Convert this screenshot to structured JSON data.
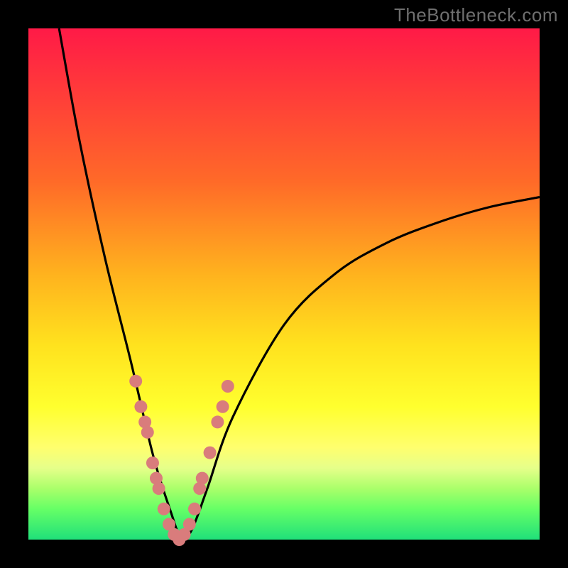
{
  "watermark": "TheBottleneck.com",
  "colors": {
    "frame": "#000000",
    "curve": "#000000",
    "marker": "#d97c7c",
    "gradient_top": "#ff1a47",
    "gradient_bottom": "#20e07a"
  },
  "chart_data": {
    "type": "line",
    "title": "",
    "xlabel": "",
    "ylabel": "",
    "xlim": [
      0,
      100
    ],
    "ylim": [
      0,
      100
    ],
    "grid": false,
    "legend": false,
    "series": [
      {
        "name": "bottleneck-curve",
        "x": [
          6,
          10,
          15,
          20,
          24,
          26,
          28,
          29,
          30,
          32,
          35,
          40,
          50,
          60,
          70,
          80,
          90,
          100
        ],
        "y": [
          100,
          78,
          55,
          35,
          18,
          11,
          5,
          2,
          0,
          2,
          10,
          24,
          42,
          52,
          58,
          62,
          65,
          67
        ]
      }
    ],
    "markers": {
      "name": "highlighted-points",
      "x": [
        21.0,
        22.0,
        22.8,
        23.3,
        24.3,
        25.0,
        25.5,
        26.5,
        27.5,
        28.5,
        29.5,
        30.5,
        31.5,
        32.5,
        33.5,
        34.0,
        35.5,
        37.0,
        38.0,
        39.0
      ],
      "y": [
        31,
        26,
        23,
        21,
        15,
        12,
        10,
        6,
        3,
        1,
        0,
        1,
        3,
        6,
        10,
        12,
        17,
        23,
        26,
        30
      ]
    }
  }
}
